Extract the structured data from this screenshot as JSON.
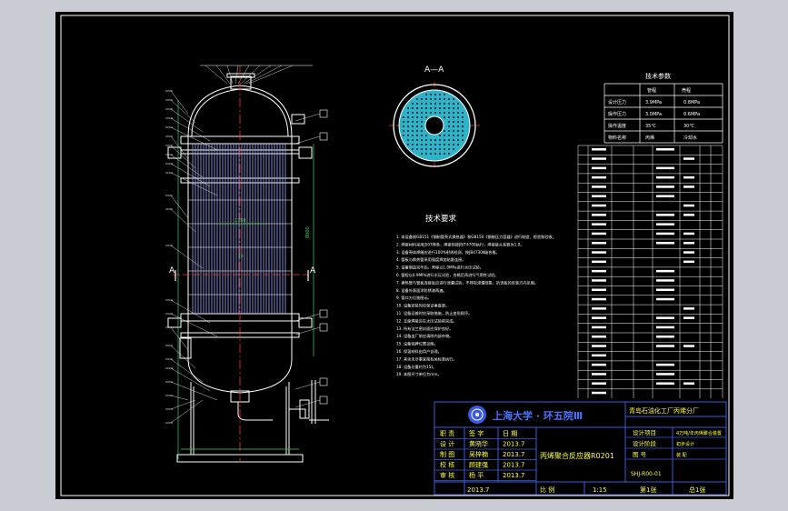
{
  "section_label": "A—A",
  "section_mark": "A",
  "tech_params": {
    "title": "技术参数",
    "header": [
      "",
      "管程",
      "壳程"
    ],
    "rows": [
      {
        "label": "设计压力",
        "tube": "3.9MPa",
        "shell": "0.8MPa"
      },
      {
        "label": "操作压力",
        "tube": "3.0MPa",
        "shell": "0.6MPa"
      },
      {
        "label": "操作温度",
        "tube": "35℃",
        "shell": "30℃"
      },
      {
        "label": "物料名称",
        "tube": "丙烯",
        "shell": "冷却水"
      }
    ]
  },
  "tech_req": {
    "title": "技术要求",
    "lines": [
      "1. 本设备按GB151《钢制管壳式换热器》和GB150《钢制压力容器》进行制造、检验和验收。",
      "2. 焊接材料采用J507焊条，焊接时按JB/T4709执行，焊接接头系数为1.0。",
      "3. 设备壳体焊缝应进行100%射线检测，按JB4730Ⅱ级合格。",
      "4. 管板与换热管采用强度焊加贴胀连接。",
      "5. 设备制造完毕后，壳程以1.0MPa进行水压试验。",
      "6. 管程以4.9MPa进行水压试验，合格后再进行气密性试验。",
      "7. 换热管与管板连接处应进行泄漏试验，不得有渗漏现象，折流板的安装方向见图。",
      "8. 设备外表面涂防锈漆两遍。",
      "9. 管口方位按图示。",
      "10. 设备安装时应保证垂直度。",
      "11. 设备运输时应采取措施，防止变形损坏。",
      "12. 支座焊接应在水压试验前完成。",
      "13. 所有法兰密封面应保护良好。",
      "14. 设备出厂前应清除内部杂物。",
      "15. 设备铭牌位置见图。",
      "16. 保温材料由用户自理。",
      "17. 其余未尽事宜按有关标准执行。",
      "18. 设备总重约为15t。",
      "19. 本图尺寸单位为mm。"
    ]
  },
  "dims": {
    "tube_length": "1750",
    "shell_height": "8000",
    "center": "40"
  },
  "title_block": {
    "school": "上海大学 · 环五院Ⅲ",
    "factory": "青岛石油化工厂丙烯分厂",
    "drawing_name": "丙烯聚合反应器R0201",
    "drawing_no": "SHJ-R00-01",
    "roles": [
      {
        "role": "职 责",
        "name": "签 字",
        "date": "日 期"
      },
      {
        "role": "设 计",
        "name": "黄晓华",
        "date": "2013.7"
      },
      {
        "role": "制 图",
        "name": "吴梓楠",
        "date": "2013.7"
      },
      {
        "role": "校 核",
        "name": "顾建强",
        "date": "2013.7"
      },
      {
        "role": "审 核",
        "name": "杨 平",
        "date": "2013.7"
      }
    ],
    "right_rows": [
      {
        "k": "设计项目",
        "v": "4万吨/年丙烯聚合装置"
      },
      {
        "k": "设计阶段",
        "v": "初步设计"
      },
      {
        "k": "图 号",
        "v": "装 配"
      }
    ],
    "bottom": {
      "date": "2013.7",
      "scale_label": "比 例",
      "scale": "1:15",
      "sheet": "第1张",
      "total": "总1张"
    }
  },
  "colors": {
    "bg_outer": "#c9ccd3",
    "paper": "#000000",
    "line": "#ffffff",
    "tube": "#9ea8ff",
    "accent": "#ffffff",
    "center": "#ff3030",
    "cyan": "#2fb3c8",
    "title_blue": "#3a5cd8",
    "green": "#3cd45a",
    "yellow": "#ffff40"
  }
}
